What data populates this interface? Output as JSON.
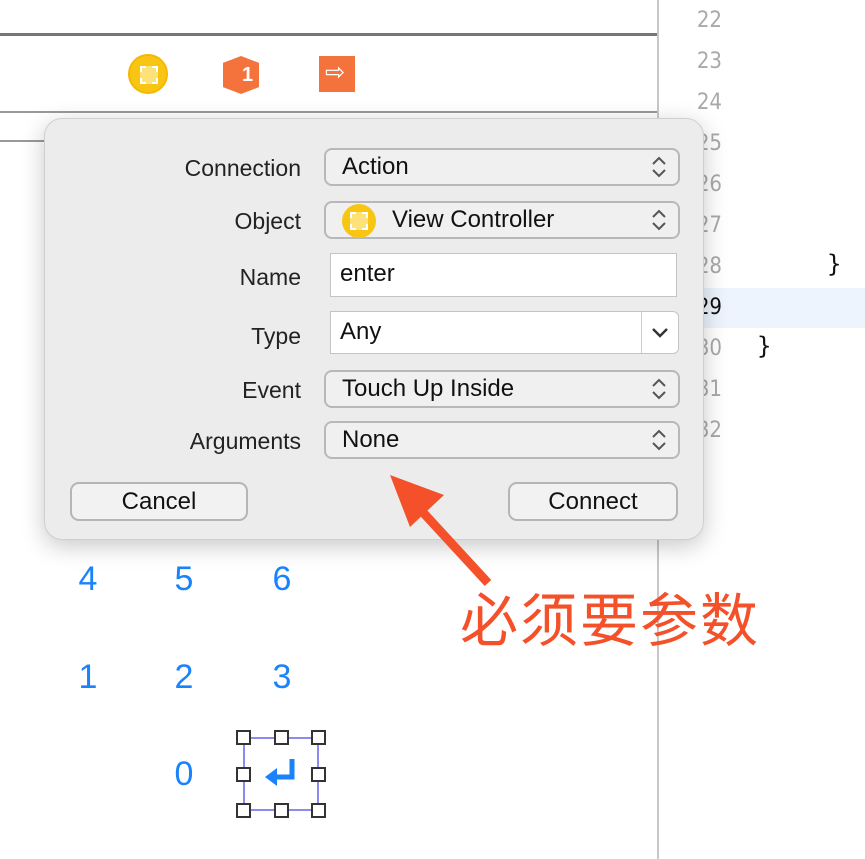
{
  "toolbar": {
    "icons": [
      "view-controller-icon",
      "first-responder-icon",
      "exit-icon"
    ]
  },
  "editor": {
    "line_numbers": [
      "22",
      "23",
      "24",
      "25",
      "26",
      "27",
      "28",
      "29",
      "30",
      "31",
      "32"
    ],
    "current_line": "29",
    "code": {
      "line28": "}",
      "line30": "}"
    }
  },
  "dialog": {
    "rows": [
      {
        "label": "Connection",
        "value": "Action"
      },
      {
        "label": "Object",
        "value": "View Controller"
      },
      {
        "label": "Name",
        "value": "enter"
      },
      {
        "label": "Type",
        "value": "Any"
      },
      {
        "label": "Event",
        "value": "Touch Up Inside"
      },
      {
        "label": "Arguments",
        "value": "None"
      }
    ],
    "cancel": "Cancel",
    "connect": "Connect"
  },
  "keypad": {
    "keys": [
      "4",
      "5",
      "6",
      "1",
      "2",
      "3",
      "0"
    ],
    "selected": "enter-key",
    "key_color": "#1a82fb"
  },
  "annotation": {
    "text": "必须要参数",
    "color": "#f4502a"
  }
}
